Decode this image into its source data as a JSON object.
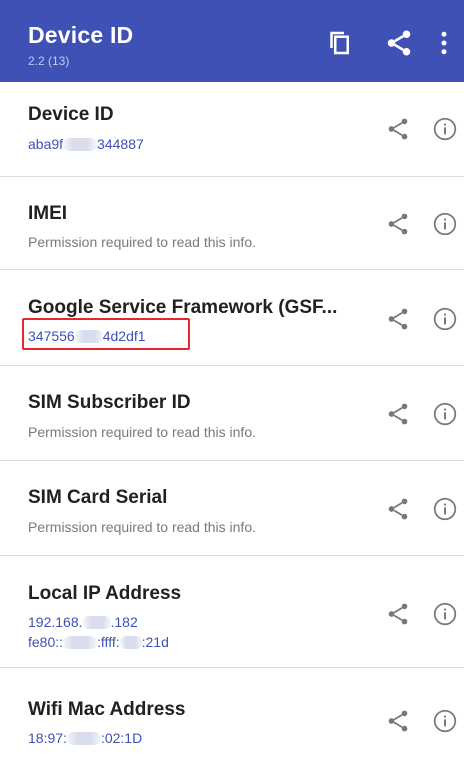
{
  "appbar": {
    "title": "Device ID",
    "version": "2.2 (13)",
    "actions": [
      "copy-icon",
      "share-icon",
      "more-vert-icon"
    ]
  },
  "colors": {
    "primary": "#3f51b5",
    "value_text": "#3f51b5",
    "highlight": "#e8272d"
  },
  "items": [
    {
      "label": "Device ID",
      "value_a": "aba9f",
      "value_b": "344887"
    },
    {
      "label": "IMEI",
      "value": "Permission required to read this info."
    },
    {
      "label": "Google Service Framework (GSF...",
      "value_a": "347556",
      "value_b": "4d2df1"
    },
    {
      "label": "SIM Subscriber ID",
      "value": "Permission required to read this info."
    },
    {
      "label": "SIM Card Serial",
      "value": "Permission required to read this info."
    },
    {
      "label": "Local IP Address",
      "ipv4_a": "192.168.",
      "ipv4_b": ".182",
      "ipv6_a": "fe80::",
      "ipv6_b": ":ffff:",
      "ipv6_c": ":21d"
    },
    {
      "label": "Wifi Mac Address",
      "value_a": "18:97:",
      "value_b": ":02:1D"
    }
  ]
}
